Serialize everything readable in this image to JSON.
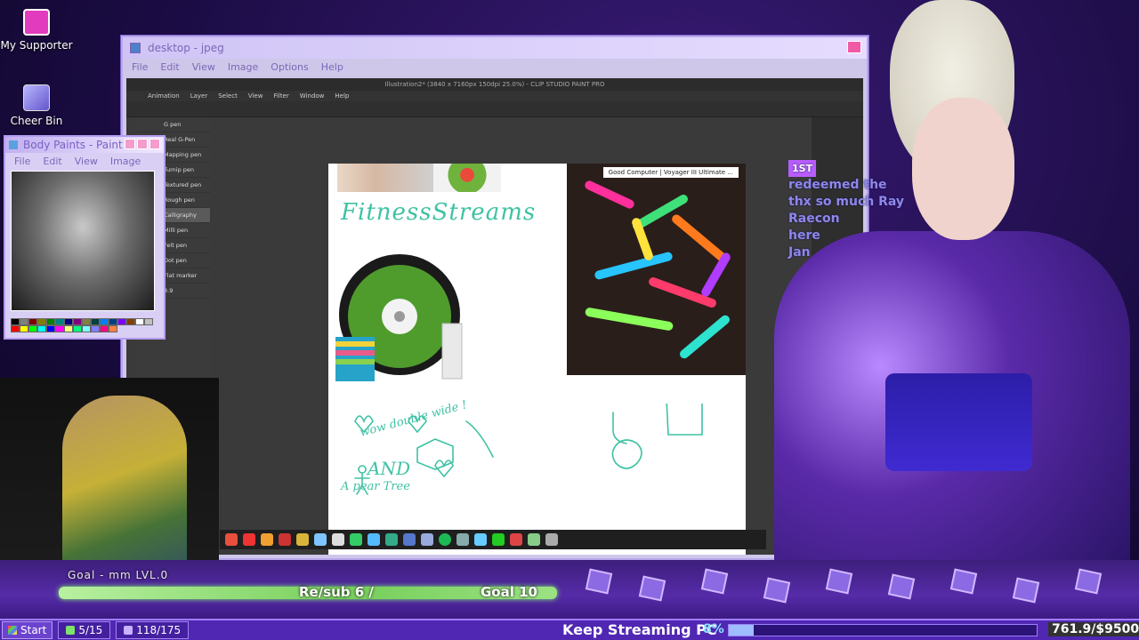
{
  "desktop": {
    "icons": [
      {
        "label": "My Supporter",
        "icon": "supporter-icon"
      },
      {
        "label": "Cheer Bin",
        "icon": "cheer-bin-icon"
      }
    ]
  },
  "main_window": {
    "title": "desktop - jpeg",
    "menu": [
      "File",
      "Edit",
      "View",
      "Image",
      "Options",
      "Help"
    ],
    "app": {
      "title": "Illustration2* (3840 x 7160px 150dpi 25.0%) - CLIP STUDIO PAINT PRO",
      "menu": [
        "Animation",
        "Layer",
        "Select",
        "View",
        "Filter",
        "Window",
        "Help"
      ],
      "brushes": [
        "G pen",
        "Real G-Pen",
        "Mapping pen",
        "Turnip pen",
        "Textured pen",
        "Rough pen",
        "Calligraphy",
        "Milli pen",
        "Felt pen",
        "Dot pen",
        "Flat marker"
      ],
      "active_brush": "Calligraphy",
      "brush_size": "8.9"
    },
    "canvas": {
      "title": "FitnessStreams",
      "balloon_label": "Good Computer | Voyager III Ultimate ...",
      "doodle_text": [
        "wow double wide !",
        "AND",
        "A pear Tree"
      ]
    }
  },
  "paint_window": {
    "title": "Body Paints - Paint",
    "menu": [
      "File",
      "Edit",
      "View",
      "Image"
    ],
    "palette": [
      "#000000",
      "#808080",
      "#800000",
      "#808000",
      "#008000",
      "#008080",
      "#000080",
      "#800080",
      "#808040",
      "#004040",
      "#0080ff",
      "#004080",
      "#8000ff",
      "#804000",
      "#ffffff",
      "#c0c0c0",
      "#ff0000",
      "#ffff00",
      "#00ff00",
      "#00ffff",
      "#0000ff",
      "#ff00ff",
      "#ffff80",
      "#00ff80",
      "#80ffff",
      "#8080ff",
      "#ff0080",
      "#ff8040"
    ]
  },
  "chat": {
    "badge": "1ST",
    "lines": [
      "redeemed the",
      "thx so much Ray",
      "Raecon",
      "here",
      "Jan"
    ]
  },
  "goal": {
    "level": "Goal - mm LVL.0",
    "sub": "Re/sub 6 /",
    "target": "Goal 10",
    "progress": 0.6
  },
  "bottom_bar": {
    "start": "Start",
    "counter1": "5/15",
    "counter2": "118/175",
    "keep_streaming": "Keep Streaming PC",
    "keep_pct": "8%",
    "keep_progress": 0.08,
    "keep_value": "761.9/$9500"
  },
  "colors": {
    "accent": "#5027b3",
    "goal_green": "#77cf5b",
    "doodle_teal": "#3fc2a4"
  }
}
